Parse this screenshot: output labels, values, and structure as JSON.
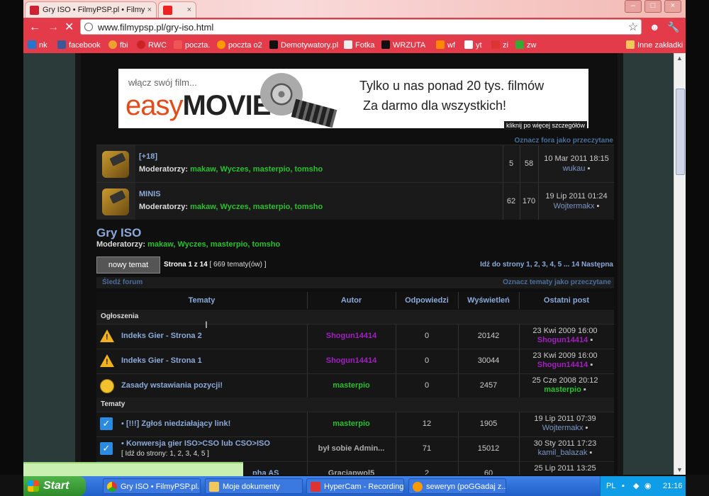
{
  "browser": {
    "tabs": [
      {
        "label": "Gry ISO • FilmyPSP.pl • Filmy"
      },
      {
        "label": ""
      }
    ],
    "url": "www.filmypsp.pl/gry-iso.html",
    "bookmarks": [
      "nk",
      "facebook",
      "fbi",
      "RWC",
      "poczta.",
      "poczta o2",
      "Demotywatory.pl",
      "Fotka",
      "WRZUTA",
      "wf",
      "yt",
      "zi",
      "zw"
    ],
    "other_bookmarks": "Inne zakładki"
  },
  "forum": {
    "banner": {
      "small": "włącz swój film...",
      "logo_easy": "easy",
      "logo_movies": "MOVIES",
      "tagline1": "Tylko u nas ponad 20 tys. filmów",
      "tagline2": "Za darmo dla wszystkich!",
      "more": "kliknij po więcej szczegółów"
    },
    "mark_forums_read": "Oznacz fora jako przeczytane",
    "subforums": [
      {
        "name": "[+18]",
        "mods_label": "Moderatorzy:",
        "mods": "makaw, Wyczes, masterpio, tomsho",
        "topics": "5",
        "posts": "58",
        "last_date": "10 Mar 2011 18:15",
        "last_user": "wukau"
      },
      {
        "name": "MINIS",
        "mods_label": "Moderatorzy:",
        "mods": "makaw, Wyczes, masterpio, tomsho",
        "topics": "62",
        "posts": "170",
        "last_date": "19 Lip 2011 01:24",
        "last_user": "Wojtermakx"
      }
    ],
    "title": "Gry ISO",
    "mods_label": "Moderatorzy:",
    "mods": "makaw, Wyczes, masterpio, tomsho",
    "new_topic_button": "nowy temat",
    "page_info_strong": "Strona 1 z 14",
    "page_info_rest": "[ 669 tematy(ów) ]",
    "pagination": "Idź do strony 1, 2, 3, 4, 5 ... 14  Następna",
    "watch_forum": "Śledź forum",
    "mark_topics_read": "Oznacz tematy jako przeczytane",
    "columns": [
      "Tematy",
      "Autor",
      "Odpowiedzi",
      "Wyświetleń",
      "Ostatni post"
    ],
    "announcements_label": "Ogłoszenia",
    "topics_label": "Tematy",
    "announcements": [
      {
        "title": "Indeks Gier - Strona 2",
        "author": "Shogun14414",
        "replies": "0",
        "views": "20142",
        "last_date": "23 Kwi 2009 16:00",
        "last_user": "Shogun14414"
      },
      {
        "title": "Indeks Gier - Strona 1",
        "author": "Shogun14414",
        "replies": "0",
        "views": "30044",
        "last_date": "23 Kwi 2009 16:00",
        "last_user": "Shogun14414"
      },
      {
        "title": "Zasady wstawiania pozycji!",
        "author": "masterpio",
        "replies": "0",
        "views": "2457",
        "last_date": "25 Cze 2008 20:12",
        "last_user": "masterpio"
      }
    ],
    "topics": [
      {
        "title": "[!!!] Zgłoś niedziałający link!",
        "author": "masterpio",
        "replies": "12",
        "views": "1905",
        "last_date": "19 Lip 2011 07:39",
        "last_user": "Wojtermakx"
      },
      {
        "title": "Konwersja gier ISO>CSO lub CSO>ISO",
        "sub": "[ Idź do strony: 1, 2, 3, 4, 5 ]",
        "author": "był sobie Admin...",
        "replies": "71",
        "views": "15012",
        "last_date": "30 Sty 2011 17:23",
        "last_user": "kamil_balazak"
      },
      {
        "title": "pha AS",
        "author": "Graciapwol5",
        "replies": "2",
        "views": "60",
        "last_date": "25 Lip 2011 13:25",
        "last_user": ""
      }
    ]
  },
  "taskbar": {
    "start": "Start",
    "tasks": [
      "Gry ISO • FilmyPSP.pl...",
      "Moje dokumenty",
      "HyperCam - Recording",
      "seweryn (poGGadaj z..."
    ],
    "lang": "PL",
    "time": "21:16"
  }
}
